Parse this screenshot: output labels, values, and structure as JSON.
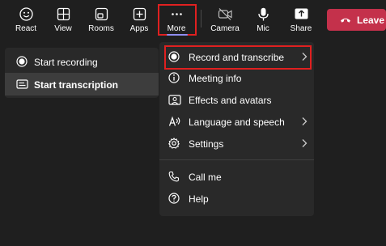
{
  "toolbar": {
    "react": "React",
    "view": "View",
    "rooms": "Rooms",
    "apps": "Apps",
    "more": "More",
    "camera": "Camera",
    "mic": "Mic",
    "share": "Share",
    "leave": "Leave"
  },
  "record_submenu": {
    "items": [
      {
        "label": "Start recording",
        "icon": "record-icon"
      },
      {
        "label": "Start transcription",
        "icon": "transcript-icon"
      }
    ]
  },
  "more_menu": {
    "items": [
      {
        "label": "Record and transcribe",
        "icon": "record-icon",
        "has_submenu": true
      },
      {
        "label": "Meeting info",
        "icon": "info-icon",
        "has_submenu": false
      },
      {
        "label": "Effects and avatars",
        "icon": "effects-icon",
        "has_submenu": false
      },
      {
        "label": "Language and speech",
        "icon": "language-icon",
        "has_submenu": true
      },
      {
        "label": "Settings",
        "icon": "gear-icon",
        "has_submenu": true
      },
      {
        "label": "Call me",
        "icon": "phone-icon",
        "has_submenu": false
      },
      {
        "label": "Help",
        "icon": "help-icon",
        "has_submenu": false
      }
    ]
  },
  "colors": {
    "background": "#1f1f1f",
    "menu": "#292929",
    "leave": "#c4314b",
    "highlight": "#e02020",
    "accent": "#8f8df0"
  }
}
